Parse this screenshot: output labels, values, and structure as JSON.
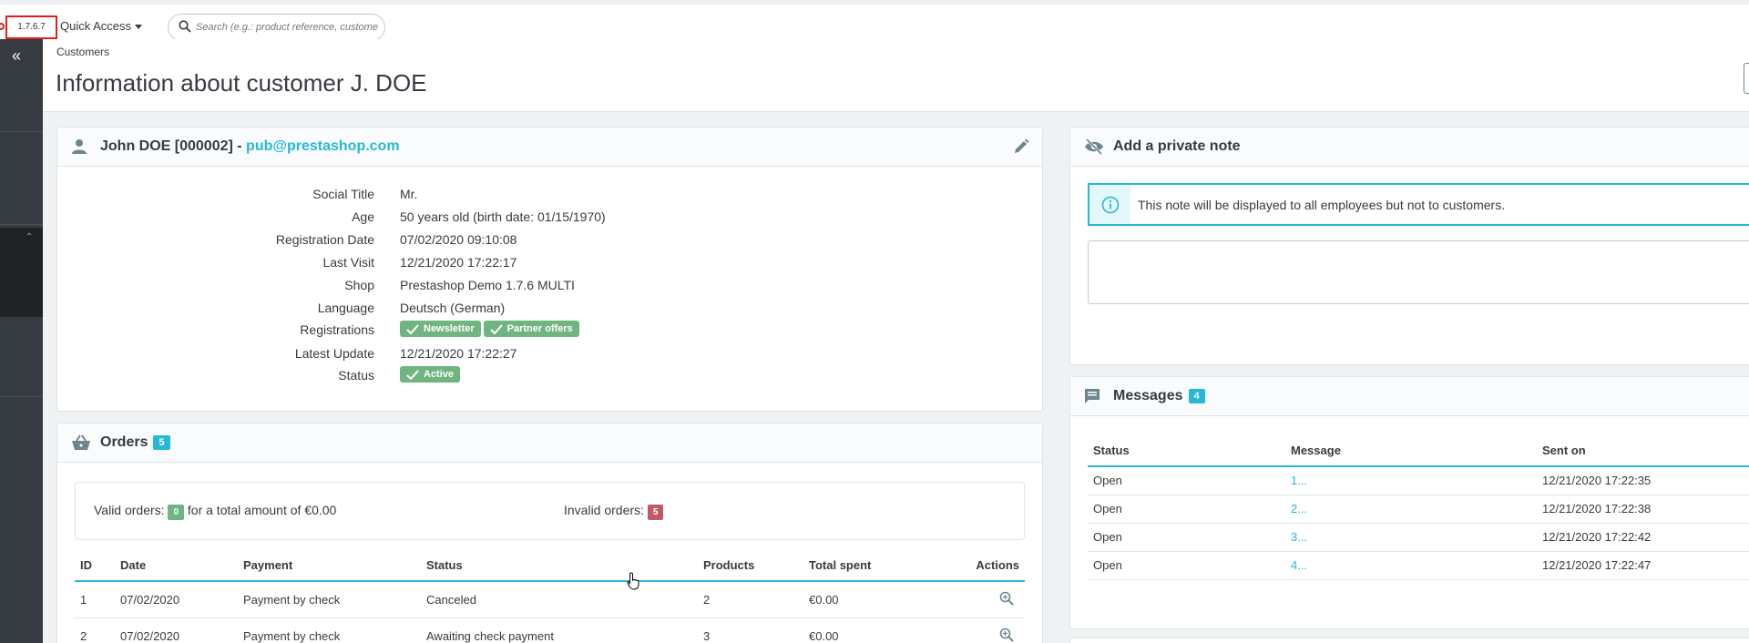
{
  "topbar": {
    "version": "1.7.6.7",
    "quick_access": "Quick Access",
    "search_placeholder": "Search (e.g.: product reference, customer name…)"
  },
  "header": {
    "breadcrumb": "Customers",
    "title": "Information about customer J. DOE"
  },
  "customer": {
    "name": "John DOE [000002] - ",
    "email": "pub@prestashop.com",
    "fields": [
      {
        "label": "Social Title",
        "value": "Mr."
      },
      {
        "label": "Age",
        "value": "50 years old (birth date: 01/15/1970)"
      },
      {
        "label": "Registration Date",
        "value": "07/02/2020 09:10:08"
      },
      {
        "label": "Last Visit",
        "value": "12/21/2020 17:22:17"
      },
      {
        "label": "Shop",
        "value": "Prestashop Demo 1.7.6 MULTI"
      },
      {
        "label": "Language",
        "value": "Deutsch (German)"
      },
      {
        "label": "Registrations",
        "value": ""
      },
      {
        "label": "Latest Update",
        "value": "12/21/2020 17:22:27"
      },
      {
        "label": "Status",
        "value": ""
      }
    ],
    "registrations": [
      "Newsletter",
      "Partner offers"
    ],
    "status": "Active"
  },
  "orders": {
    "title": "Orders",
    "count": "5",
    "valid_label": "Valid orders:",
    "valid_count": "0",
    "valid_amount": "for a total amount of €0.00",
    "invalid_label": "Invalid orders:",
    "invalid_count": "5",
    "columns": [
      "ID",
      "Date",
      "Payment",
      "Status",
      "Products",
      "Total spent",
      "Actions"
    ],
    "rows": [
      {
        "id": "1",
        "date": "07/02/2020",
        "payment": "Payment by check",
        "status": "Canceled",
        "products": "2",
        "total": "€0.00"
      },
      {
        "id": "2",
        "date": "07/02/2020",
        "payment": "Payment by check",
        "status": "Awaiting check payment",
        "products": "3",
        "total": "€0.00"
      }
    ]
  },
  "note": {
    "title": "Add a private note",
    "info": "This note will be displayed to all employees but not to customers."
  },
  "messages": {
    "title": "Messages",
    "count": "4",
    "columns": [
      "Status",
      "Message",
      "Sent on"
    ],
    "rows": [
      {
        "status": "Open",
        "message": "1...",
        "sent": "12/21/2020 17:22:35"
      },
      {
        "status": "Open",
        "message": "2...",
        "sent": "12/21/2020 17:22:38"
      },
      {
        "status": "Open",
        "message": "3...",
        "sent": "12/21/2020 17:22:42"
      },
      {
        "status": "Open",
        "message": "4...",
        "sent": "12/21/2020 17:22:47"
      }
    ]
  }
}
